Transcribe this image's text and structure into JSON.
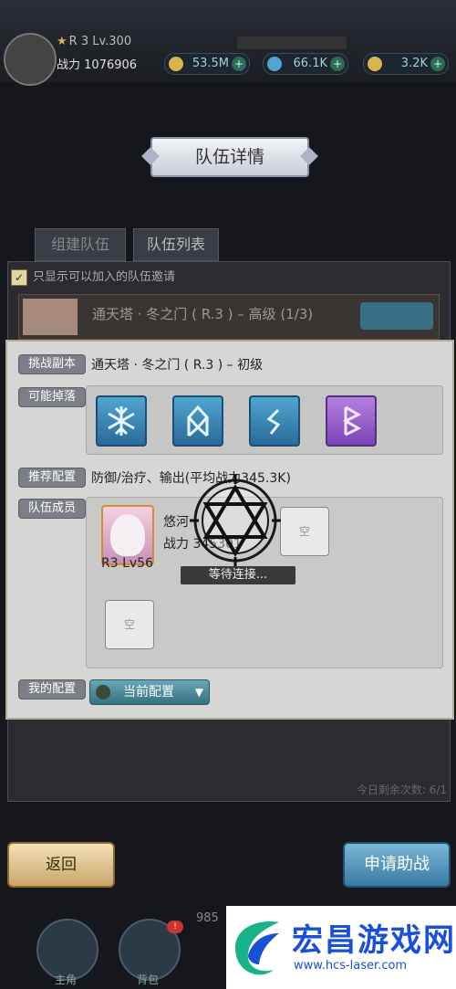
{
  "header": {
    "rank": "R 3 Lv.300",
    "power_label": "战力",
    "power_value": "1076906",
    "currencies": [
      {
        "name": "gold-coin",
        "value": "53.5M",
        "color": "#d8b44a"
      },
      {
        "name": "blue-gem",
        "value": "66.1K",
        "color": "#4fa6d0"
      },
      {
        "name": "gold-gem",
        "value": "3.2K",
        "color": "#d8b44a"
      }
    ]
  },
  "title": "队伍详情",
  "tabs": [
    "组建队伍",
    "队伍列表"
  ],
  "only_show": "只显示可以加入的队伍邀请",
  "bg_team": "通天塔 · 冬之门 ( R.3 ) – 高级 (1/3)",
  "dialog": {
    "challenge_label": "挑战副本",
    "challenge_value": "通天塔 · 冬之门 ( R.3 ) – 初级",
    "drops_label": "可能掉落",
    "recommend_label": "推荐配置",
    "recommend_value": "防御/治疗、输出(平均战力345.3K)",
    "members_label": "队伍成员",
    "member": {
      "name": "悠河",
      "power_label": "战力",
      "power": "345301",
      "rank": "R3",
      "level": "Lv56"
    },
    "empty_label": "空",
    "waiting": "等待连接...",
    "my_config_label": "我的配置",
    "my_config_value": "当前配置"
  },
  "remaining": "今日剩余次数: 6/1",
  "buttons": {
    "back": "返回",
    "help": "申请助战"
  },
  "nav": {
    "labels": [
      "主角",
      "背包"
    ],
    "mid": "985"
  },
  "watermark": {
    "brand": "宏昌游戏网",
    "url": "www.hcs-laser.com"
  }
}
